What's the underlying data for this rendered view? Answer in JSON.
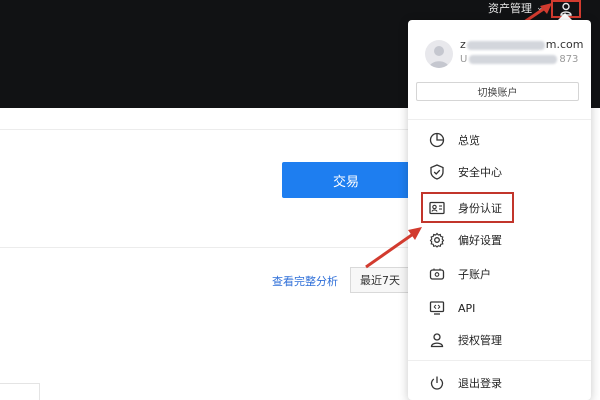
{
  "topbar": {
    "asset_menu_label": "资产管理",
    "icon": "user-icon"
  },
  "main": {
    "trade_button": "交易",
    "analysis_link": "查看完整分析",
    "range_label": "最近7天"
  },
  "dropdown": {
    "account": {
      "email_prefix": "z",
      "email_suffix": "m.com",
      "uid_prefix": "U",
      "uid_suffix": "873"
    },
    "switch_account": "切换账户",
    "items": [
      {
        "label": "总览",
        "icon": "pie-chart-icon"
      },
      {
        "label": "安全中心",
        "icon": "shield-check-icon"
      },
      {
        "label": "身份认证",
        "icon": "id-card-icon"
      },
      {
        "label": "偏好设置",
        "icon": "gear-icon"
      },
      {
        "label": "子账户",
        "icon": "sub-account-icon"
      },
      {
        "label": "API",
        "icon": "api-monitor-icon"
      },
      {
        "label": "授权管理",
        "icon": "person-auth-icon"
      }
    ],
    "logout": {
      "label": "退出登录",
      "icon": "power-icon"
    }
  },
  "colors": {
    "topbar_bg": "#111214",
    "accent_blue": "#1e7ef0",
    "annotation_red": "#d23b2f"
  }
}
